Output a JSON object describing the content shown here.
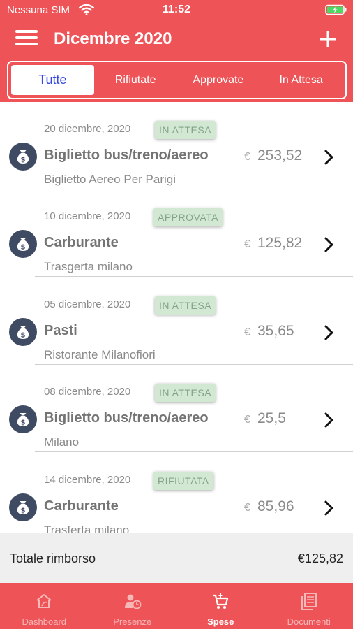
{
  "status_bar": {
    "carrier": "Nessuna SIM",
    "time": "11:52"
  },
  "header": {
    "title": "Dicembre 2020"
  },
  "filters": {
    "tabs": [
      {
        "label": "Tutte"
      },
      {
        "label": "Rifiutate"
      },
      {
        "label": "Approvate"
      },
      {
        "label": "In Attesa"
      }
    ],
    "selected": "Tutte"
  },
  "expenses": [
    {
      "date": "20 dicembre, 2020",
      "status": "IN ATTESA",
      "category": "Biglietto bus/treno/aereo",
      "description": "Biglietto Aereo Per Parigi",
      "currency": "€",
      "amount": "253,52"
    },
    {
      "date": "10 dicembre, 2020",
      "status": "APPROVATA",
      "category": "Carburante",
      "description": "Trasgerta milano",
      "currency": "€",
      "amount": "125,82"
    },
    {
      "date": "05 dicembre, 2020",
      "status": "IN ATTESA",
      "category": "Pasti",
      "description": "Ristorante Milanofiori",
      "currency": "€",
      "amount": "35,65"
    },
    {
      "date": "08 dicembre, 2020",
      "status": "IN ATTESA",
      "category": "Biglietto bus/treno/aereo",
      "description": "Milano",
      "currency": "€",
      "amount": "25,5"
    },
    {
      "date": "14 dicembre, 2020",
      "status": "RIFIUTATA",
      "category": "Carburante",
      "description": "Trasferta milano",
      "currency": "€",
      "amount": "85,96"
    }
  ],
  "total": {
    "label": "Totale rimborso",
    "value": "€125,82"
  },
  "tab_bar": {
    "items": [
      {
        "label": "Dashboard",
        "icon": "home-icon"
      },
      {
        "label": "Presenze",
        "icon": "user-clock-icon"
      },
      {
        "label": "Spese",
        "icon": "cart-icon"
      },
      {
        "label": "Documenti",
        "icon": "documents-icon"
      }
    ],
    "active": "Spese"
  },
  "colors": {
    "primary": "#ee5457",
    "tab_active_text": "#3448e0",
    "badge_bg": "#d2e8d2",
    "avatar": "#3f4b63"
  }
}
